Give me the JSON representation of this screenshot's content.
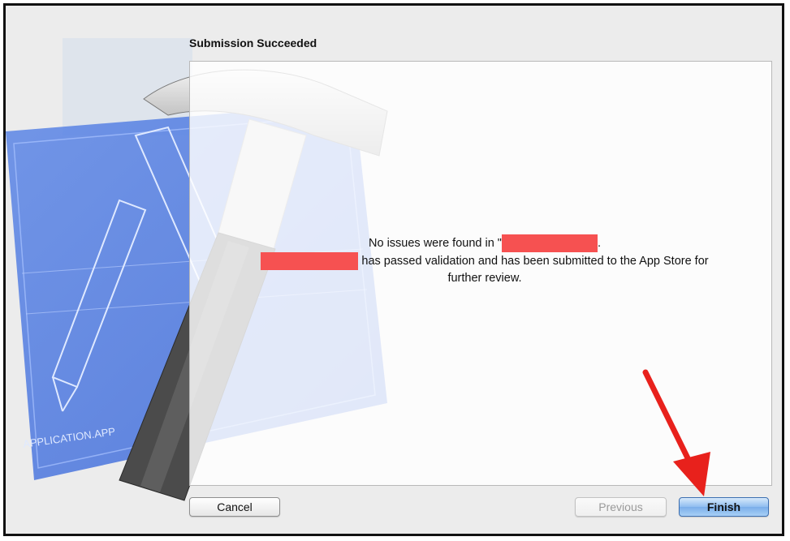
{
  "dialog": {
    "title": "Submission Succeeded",
    "message_line1_prefix": "No issues were found in \"",
    "message_line1_suffix": ".",
    "message_line2": "has passed validation and has been submitted to the App Store for",
    "message_line3": "further review."
  },
  "buttons": {
    "cancel": "Cancel",
    "previous": "Previous",
    "finish": "Finish"
  },
  "hero": {
    "blueprint_text": "APPLICATION.APP"
  },
  "colors": {
    "redaction": "#f65151",
    "annotation_arrow": "#e8211c",
    "finish_button": "#8fbdf0"
  }
}
